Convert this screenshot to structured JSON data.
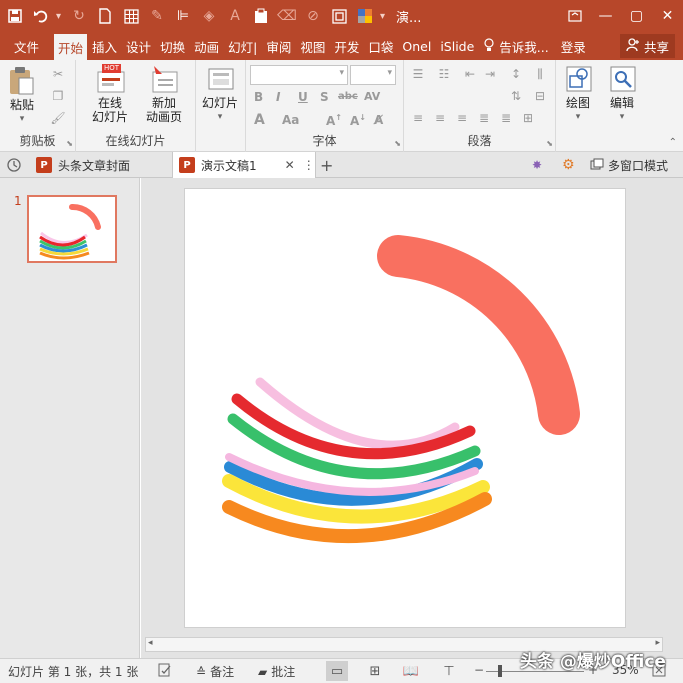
{
  "app": {
    "doc_title": "演...",
    "accent": "#b7472a"
  },
  "qat": {
    "icons": [
      "save-icon",
      "undo-icon",
      "redo-icon",
      "new-doc-icon",
      "grid-icon",
      "pen-icon",
      "align-icon",
      "shape-fill-icon",
      "font-color-icon",
      "paste-icon",
      "eraser-icon",
      "clear-icon",
      "frame-icon",
      "color-picker-icon"
    ]
  },
  "window": {
    "help": "?",
    "minimize": "—",
    "restore": "▢",
    "close": "✕"
  },
  "tabs": {
    "items": [
      "文件",
      "开始",
      "插入",
      "设计",
      "切换",
      "动画",
      "幻灯|",
      "审阅",
      "视图",
      "开发",
      "口袋",
      "Onel",
      "iSlide"
    ],
    "active": "开始",
    "tell_me": "告诉我...",
    "login": "登录",
    "share": "共享"
  },
  "ribbon": {
    "clipboard": {
      "paste": "粘贴",
      "label": "剪贴板"
    },
    "online": {
      "online_slide": "在线",
      "online_slide2": "幻灯片",
      "new_anim": "新加",
      "new_anim2": "动画页",
      "hot": "HOT",
      "label": "在线幻灯片"
    },
    "slides": {
      "slide": "幻灯片"
    },
    "font": {
      "label": "字体",
      "bold": "B",
      "italic": "I",
      "underline": "U",
      "shadow": "S",
      "strike": "abc",
      "spacing": "AV",
      "case": "Aa"
    },
    "paragraph": {
      "label": "段落"
    },
    "drawing": {
      "draw": "绘图",
      "edit": "编辑"
    }
  },
  "doc_tabs": {
    "tab1": "头条文章封面",
    "tab2": "演示文稿1",
    "add": "+",
    "multi_window": "多窗口模式"
  },
  "thumbnails": {
    "slide_number": "1"
  },
  "statusbar": {
    "slide_info": "幻灯片 第 1 张，共 1 张",
    "notes": "备注",
    "comments": "批注",
    "zoom": "35%",
    "watermark": "头条 @爆炒Office"
  }
}
